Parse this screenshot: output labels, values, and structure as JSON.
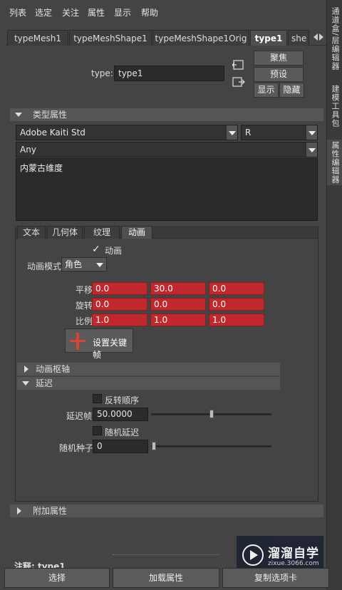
{
  "menu": [
    "列表",
    "选定",
    "关注",
    "属性",
    "显示",
    "帮助"
  ],
  "right_tabs": [
    "通道盒/层编辑器",
    "建模工具包",
    "属性编辑器"
  ],
  "tabs": [
    "typeMesh1",
    "typeMeshShape1",
    "typeMeshShape1Orig",
    "type1",
    "she"
  ],
  "type_label": "type:",
  "type_value": "type1",
  "buttons": {
    "focus": "聚焦",
    "preset": "预设",
    "show": "显示",
    "hide": "隐藏"
  },
  "section_type_attrs": "类型属性",
  "font_family": "Adobe Kaiti Std",
  "font_style": "R",
  "writing_system": "Any",
  "text_content": "内蒙古维度",
  "sub_tabs": [
    "文本",
    "几何体",
    "纹理",
    "动画"
  ],
  "animation": {
    "enable_label": "动画",
    "mode_label": "动画模式",
    "mode_value": "角色",
    "rows": [
      {
        "label": "平移",
        "values": [
          "0.0",
          "30.0",
          "0.0"
        ]
      },
      {
        "label": "旋转",
        "values": [
          "0.0",
          "0.0",
          "0.0"
        ]
      },
      {
        "label": "比例",
        "values": [
          "1.0",
          "1.0",
          "1.0"
        ]
      }
    ],
    "set_key_label": "设置关键帧",
    "pivot_section": "动画枢轴",
    "delay_section": "延迟",
    "reverse_order_label": "反转顺序",
    "delay_frames_label": "延迟帧",
    "delay_frames_value": "50.0000",
    "delay_slider_fraction": 0.5,
    "random_delay_label": "随机延迟",
    "random_seed_label": "随机种子",
    "random_seed_value": "0",
    "seed_slider_fraction": 0.0
  },
  "extra_attrs": "附加属性",
  "notes_label": "注释: type1",
  "bottom_buttons": [
    "选择",
    "加载属性",
    "复制选项卡"
  ],
  "watermark": {
    "title": "溜溜自学",
    "url": "zixue.3066.com"
  }
}
